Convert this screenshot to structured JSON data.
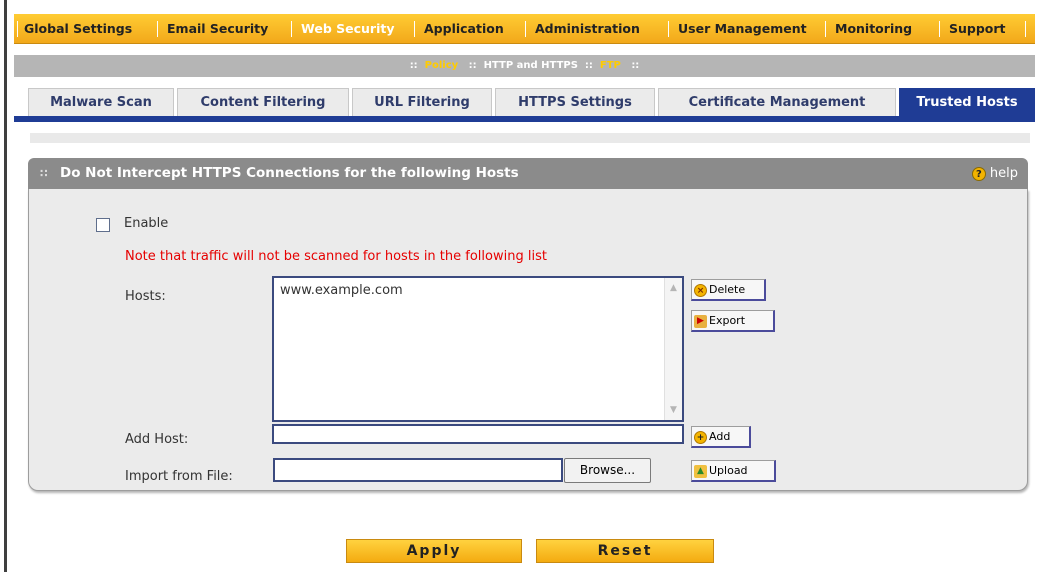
{
  "topnav": {
    "items": [
      {
        "label": "Global Settings",
        "active": false
      },
      {
        "label": "Email Security",
        "active": false
      },
      {
        "label": "Web Security",
        "active": true
      },
      {
        "label": "Application",
        "active": false
      },
      {
        "label": "Administration",
        "active": false
      },
      {
        "label": "User Management",
        "active": false
      },
      {
        "label": "Monitoring",
        "active": false
      },
      {
        "label": "Support",
        "active": false
      }
    ]
  },
  "subnav": {
    "sep": "::",
    "items": [
      {
        "label": "Policy",
        "active": true
      },
      {
        "label": "HTTP and HTTPS",
        "active": false
      },
      {
        "label": "FTP",
        "active": true
      }
    ]
  },
  "tabs": [
    {
      "label": "Malware Scan",
      "active": false
    },
    {
      "label": "Content Filtering",
      "active": false
    },
    {
      "label": "URL Filtering",
      "active": false
    },
    {
      "label": "HTTPS Settings",
      "active": false
    },
    {
      "label": "Certificate Management",
      "active": false
    },
    {
      "label": "Trusted Hosts",
      "active": true
    }
  ],
  "section": {
    "grip": "∷",
    "title": "Do Not Intercept HTTPS Connections for the following Hosts",
    "help_label": "help",
    "help_icon_glyph": "?"
  },
  "form": {
    "enable_label": "Enable",
    "enable_checked": false,
    "note": "Note that traffic will not be scanned for hosts in the following list",
    "hosts_label": "Hosts:",
    "hosts": [
      "www.example.com"
    ],
    "add_host_label": "Add Host:",
    "add_host_value": "",
    "import_label": "Import from File:",
    "import_value": "",
    "browse_label": "Browse..."
  },
  "buttons": {
    "delete": "Delete",
    "export": "Export",
    "add": "Add",
    "upload": "Upload",
    "apply": "Apply",
    "reset": "Reset"
  },
  "colors": {
    "nav_bg": "#f2a81a",
    "tab_active": "#1f3c95",
    "note_text": "#e60000",
    "section_header": "#8b8b8b"
  },
  "icons": {
    "delete": "x-circle-icon",
    "export": "export-icon",
    "add": "plus-circle-icon",
    "upload": "upload-folder-icon",
    "help": "help-icon"
  }
}
